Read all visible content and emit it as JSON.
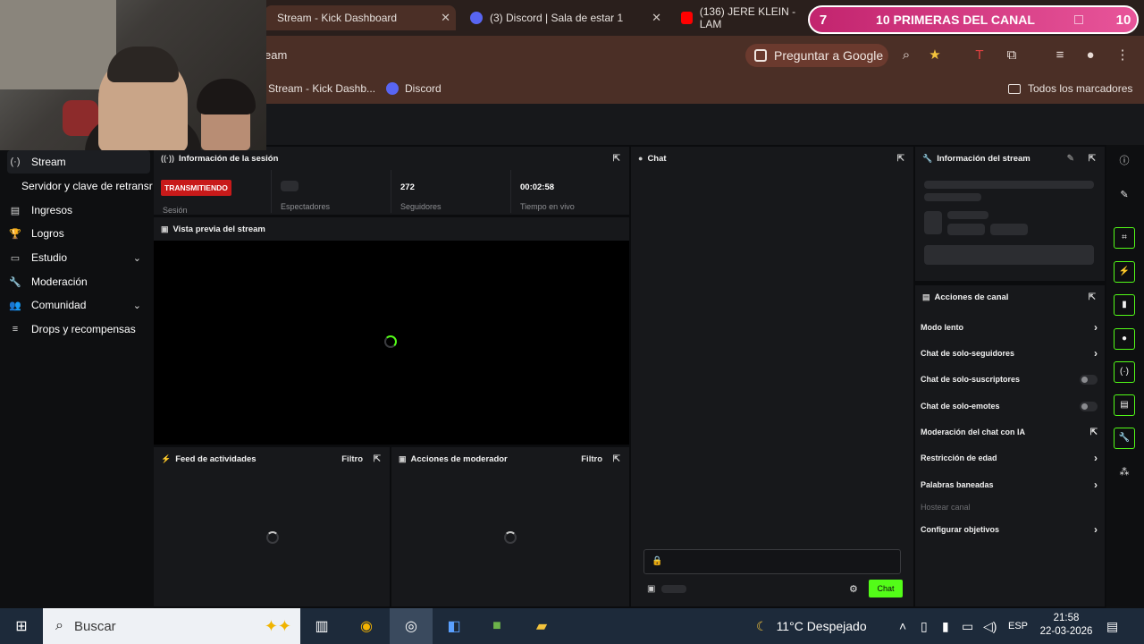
{
  "browser": {
    "tabs": [
      {
        "title": "Stream - Kick Dashboard",
        "active": true
      },
      {
        "title": "(3) Discord | Sala de estar 1"
      },
      {
        "title": "(136) JERE KLEIN - LAM"
      }
    ],
    "address": "eam",
    "google_pill": "Preguntar a Google",
    "bookmarks": [
      {
        "label": "Stream - Kick Dashb..."
      },
      {
        "label": "Discord"
      }
    ],
    "all_bookmarks": "Todos los marcadores"
  },
  "overlay": {
    "left_count": "7",
    "label": "10 PRIMERAS DEL CANAL",
    "right_count": "10"
  },
  "sidebar": {
    "items": [
      {
        "label": "Stream",
        "icon": "broadcast-icon",
        "glyph": "(·)",
        "active": true
      },
      {
        "label": "Servidor y clave de retransr",
        "sub": true
      },
      {
        "label": "Ingresos",
        "icon": "revenue-icon",
        "glyph": "▤"
      },
      {
        "label": "Logros",
        "icon": "trophy-icon",
        "glyph": "🏆"
      },
      {
        "label": "Estudio",
        "icon": "studio-icon",
        "glyph": "▭",
        "chevron": true
      },
      {
        "label": "Moderación",
        "icon": "wrench-icon",
        "glyph": "🔧"
      },
      {
        "label": "Comunidad",
        "icon": "community-icon",
        "glyph": "👥",
        "chevron": true
      },
      {
        "label": "Drops y recompensas",
        "icon": "drops-icon",
        "glyph": "≡"
      }
    ]
  },
  "session": {
    "title": "Información de la sesión",
    "badge": "TRANSMITIENDO",
    "session_label": "Sesión",
    "viewers_label": "Espectadores",
    "followers_value": "272",
    "followers_label": "Seguidores",
    "live_time": "00:02:58",
    "live_time_label": "Tiempo en vivo"
  },
  "preview": {
    "title": "Vista previa del stream"
  },
  "activity": {
    "title": "Feed de actividades",
    "filter": "Filtro"
  },
  "modactions": {
    "title": "Acciones de moderador",
    "filter": "Filtro"
  },
  "chat": {
    "title": "Chat",
    "send": "Chat"
  },
  "stream_info": {
    "title": "Información del stream"
  },
  "channel_actions": {
    "title": "Acciones de canal",
    "items": [
      {
        "label": "Modo lento",
        "kind": "chevron"
      },
      {
        "label": "Chat de solo-seguidores",
        "kind": "chevron"
      },
      {
        "label": "Chat de solo-suscriptores",
        "kind": "toggle"
      },
      {
        "label": "Chat de solo-emotes",
        "kind": "toggle"
      },
      {
        "label": "Moderación del chat con IA",
        "kind": "external"
      },
      {
        "label": "Restricción de edad",
        "kind": "chevron"
      },
      {
        "label": "Palabras baneadas",
        "kind": "chevron"
      },
      {
        "label": "Hostear canal",
        "kind": "disabled"
      },
      {
        "label": "Configurar objetivos",
        "kind": "chevron"
      }
    ]
  },
  "taskbar": {
    "search_placeholder": "Buscar",
    "weather": "11°C  Despejado",
    "language": "ESP",
    "time": "21:58",
    "date": "22-03-2026"
  },
  "colors": {
    "accent": "#53fc18",
    "live": "#c81a1a",
    "overlay": "#c2246e"
  }
}
